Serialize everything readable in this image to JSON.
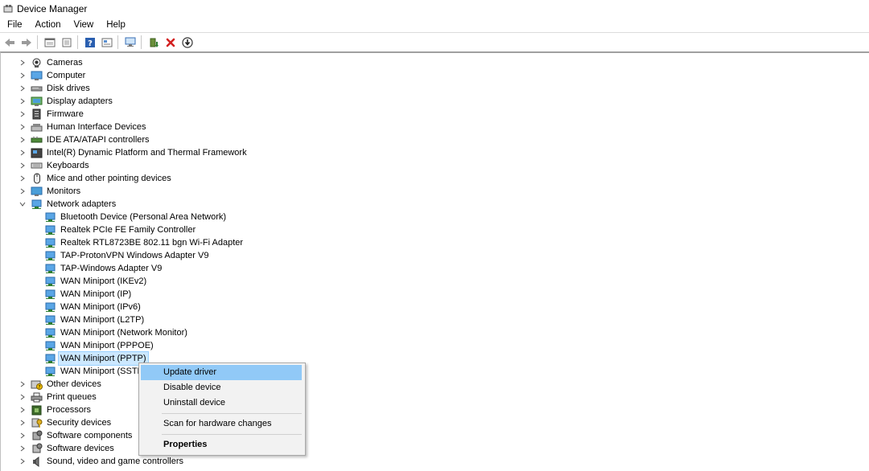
{
  "window": {
    "title": "Device Manager"
  },
  "menu": [
    "File",
    "Action",
    "View",
    "Help"
  ],
  "toolbar": {
    "buttons": [
      "back-icon",
      "forward-icon",
      "properties-icon",
      "view-icon",
      "help-icon",
      "show-hidden-icon",
      "scan-hardware-icon",
      "update-driver-icon",
      "uninstall-icon",
      "enable-device-icon"
    ]
  },
  "tree": {
    "categories_top": [
      {
        "label": "Cameras",
        "icon": "camera-icon"
      },
      {
        "label": "Computer",
        "icon": "computer-icon"
      },
      {
        "label": "Disk drives",
        "icon": "disk-drive-icon"
      },
      {
        "label": "Display adapters",
        "icon": "display-adapter-icon"
      },
      {
        "label": "Firmware",
        "icon": "firmware-icon"
      },
      {
        "label": "Human Interface Devices",
        "icon": "hid-icon"
      },
      {
        "label": "IDE ATA/ATAPI controllers",
        "icon": "ide-controller-icon"
      },
      {
        "label": "Intel(R) Dynamic Platform and Thermal Framework",
        "icon": "thermal-framework-icon"
      },
      {
        "label": "Keyboards",
        "icon": "keyboard-icon"
      },
      {
        "label": "Mice and other pointing devices",
        "icon": "mouse-icon"
      },
      {
        "label": "Monitors",
        "icon": "monitor-icon"
      }
    ],
    "expanded": {
      "label": "Network adapters",
      "icon": "network-adapter-icon"
    },
    "network_children": [
      "Bluetooth Device (Personal Area Network)",
      "Realtek PCIe FE Family Controller",
      "Realtek RTL8723BE 802.11 bgn Wi-Fi Adapter",
      "TAP-ProtonVPN Windows Adapter V9",
      "TAP-Windows Adapter V9",
      "WAN Miniport (IKEv2)",
      "WAN Miniport (IP)",
      "WAN Miniport (IPv6)",
      "WAN Miniport (L2TP)",
      "WAN Miniport (Network Monitor)",
      "WAN Miniport (PPPOE)",
      "WAN Miniport (PPTP)",
      "WAN Miniport (SSTP"
    ],
    "selected_child": "WAN Miniport (PPTP)",
    "categories_bottom": [
      {
        "label": "Other devices",
        "icon": "other-devices-icon"
      },
      {
        "label": "Print queues",
        "icon": "printer-icon"
      },
      {
        "label": "Processors",
        "icon": "processor-icon"
      },
      {
        "label": "Security devices",
        "icon": "security-device-icon"
      },
      {
        "label": "Software components",
        "icon": "software-component-icon"
      },
      {
        "label": "Software devices",
        "icon": "software-device-icon"
      },
      {
        "label": "Sound, video and game controllers",
        "icon": "speaker-icon"
      }
    ]
  },
  "context_menu": {
    "update": "Update driver",
    "disable": "Disable device",
    "uninstall": "Uninstall device",
    "scan": "Scan for hardware changes",
    "properties": "Properties"
  },
  "colors": {
    "selection": "#cce8ff",
    "menu_hover": "#91c9f7",
    "uninstall_red": "#d32020",
    "adapter_blue": "#2f8fd8"
  }
}
